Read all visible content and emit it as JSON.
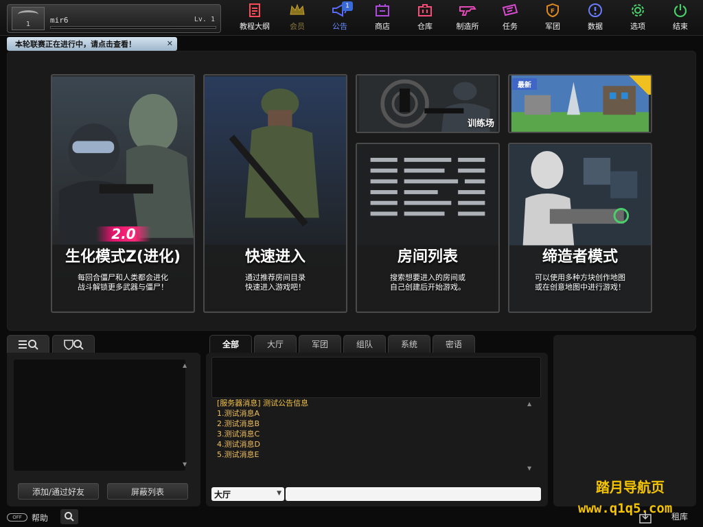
{
  "profile": {
    "rank_number": "1",
    "name": "mir6",
    "level": "Lv. 1"
  },
  "nav": [
    {
      "key": "tutorial",
      "label": "教程大纲",
      "icon": "notebook-icon",
      "color": "#ff4a5a"
    },
    {
      "key": "member",
      "label": "会员",
      "icon": "crown-icon",
      "color": "#c9a227"
    },
    {
      "key": "notice",
      "label": "公告",
      "icon": "megaphone-icon",
      "color": "#5a6cff",
      "badge": "1"
    },
    {
      "key": "shop",
      "label": "商店",
      "icon": "cart-icon",
      "color": "#b04ae0"
    },
    {
      "key": "storage",
      "label": "仓库",
      "icon": "briefcase-icon",
      "color": "#ff4a7a"
    },
    {
      "key": "craft",
      "label": "制造所",
      "icon": "gun-icon",
      "color": "#e64ab8"
    },
    {
      "key": "task",
      "label": "任务",
      "icon": "ticket-icon",
      "color": "#d94ad0"
    },
    {
      "key": "clan",
      "label": "军团",
      "icon": "shield-icon",
      "color": "#e08a20"
    },
    {
      "key": "data",
      "label": "数据",
      "icon": "info-icon",
      "color": "#6a7cff"
    },
    {
      "key": "options",
      "label": "选项",
      "icon": "gear-icon",
      "color": "#4ad06a"
    },
    {
      "key": "exit",
      "label": "结束",
      "icon": "power-icon",
      "color": "#4ad06a"
    }
  ],
  "notice_bar": {
    "text": "本轮联赛正在进行中，请点击查看！",
    "close": "✕"
  },
  "modes": {
    "zombie": {
      "badge": "2.0",
      "title": "生化模式Z(进化)",
      "desc1": "每回合僵尸和人类都会进化",
      "desc2": "战斗解锁更多武器与僵尸！"
    },
    "quick": {
      "title": "快速进入",
      "desc1": "通过推荐房间目录",
      "desc2": "快速进入游戏吧！"
    },
    "training": {
      "label": "训练场"
    },
    "newmap": {
      "tag": "最新"
    },
    "rooms": {
      "title": "房间列表",
      "desc1": "搜索想要进入的房间或",
      "desc2": "自己创建后开始游戏。"
    },
    "creator": {
      "title": "缔造者模式",
      "desc1": "可以使用多种方块创作地图",
      "desc2": "或在创意地图中进行游戏！"
    }
  },
  "friends": {
    "add_button": "添加/通过好友",
    "block_button": "屏蔽列表"
  },
  "chat": {
    "tabs": [
      "全部",
      "大厅",
      "军团",
      "组队",
      "系统",
      "密语"
    ],
    "messages": [
      "[服务器消息] 测试公告信息",
      "1.测试消息A",
      "2.测试消息B",
      "3.测试消息C",
      "4.测试消息D",
      "5.测试消息E"
    ],
    "channel": "大厅",
    "input_value": ""
  },
  "watermark": {
    "line1": "踏月导航页",
    "line2": "www.q1q5.com"
  },
  "status": {
    "help_toggle": "OFF",
    "help_label": "帮助",
    "br_label": "租库"
  }
}
